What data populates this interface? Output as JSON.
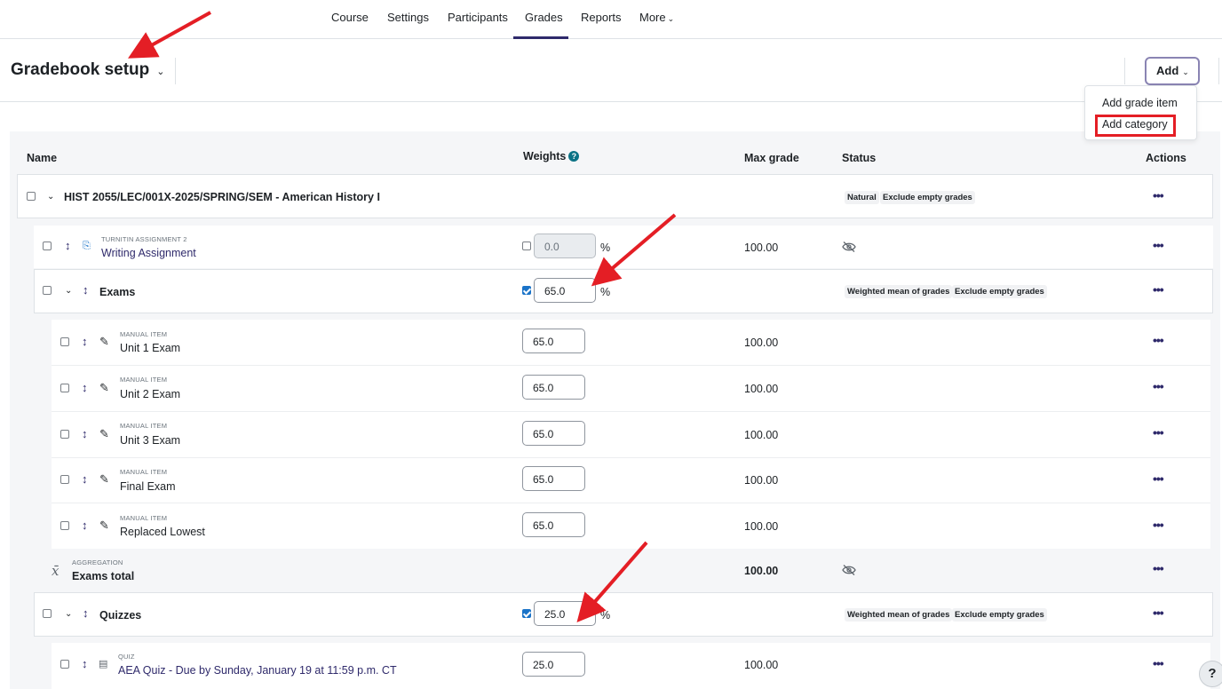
{
  "nav": {
    "items": [
      "Course",
      "Settings",
      "Participants",
      "Grades",
      "Reports",
      "More"
    ],
    "active": "Grades"
  },
  "header": {
    "title": "Gradebook setup",
    "add_button": "Add"
  },
  "add_menu": {
    "items": [
      "Add grade item",
      "Add category"
    ],
    "highlighted": "Add category"
  },
  "table": {
    "columns": {
      "name": "Name",
      "weights": "Weights",
      "max_grade": "Max grade",
      "status": "Status",
      "actions": "Actions"
    },
    "course": {
      "name": "HIST 2055/LEC/001X-2025/SPRING/SEM - American History I",
      "status": [
        "Natural",
        "Exclude empty grades"
      ]
    },
    "writing": {
      "type": "TURNITIN ASSIGNMENT 2",
      "name": "Writing Assignment",
      "weight": "0.0",
      "weight_checked": false,
      "pct": "%",
      "max": "100.00"
    },
    "exams": {
      "name": "Exams",
      "weight": "65.0",
      "weight_checked": true,
      "pct": "%",
      "status": [
        "Weighted mean of grades",
        "Exclude empty grades"
      ],
      "items": [
        {
          "type": "MANUAL ITEM",
          "name": "Unit 1 Exam",
          "weight": "65.0",
          "max": "100.00"
        },
        {
          "type": "MANUAL ITEM",
          "name": "Unit 2 Exam",
          "weight": "65.0",
          "max": "100.00"
        },
        {
          "type": "MANUAL ITEM",
          "name": "Unit 3 Exam",
          "weight": "65.0",
          "max": "100.00"
        },
        {
          "type": "MANUAL ITEM",
          "name": "Final Exam",
          "weight": "65.0",
          "max": "100.00"
        },
        {
          "type": "MANUAL ITEM",
          "name": "Replaced Lowest",
          "weight": "65.0",
          "max": "100.00"
        }
      ],
      "total": {
        "type": "AGGREGATION",
        "name": "Exams total",
        "max": "100.00"
      }
    },
    "quizzes": {
      "name": "Quizzes",
      "weight": "25.0",
      "weight_checked": true,
      "pct": "%",
      "status": [
        "Weighted mean of grades",
        "Exclude empty grades"
      ],
      "items": [
        {
          "type": "QUIZ",
          "name": "AEA Quiz - Due by Sunday, January 19 at 11:59 p.m. CT",
          "weight": "25.0",
          "max": "100.00"
        }
      ]
    }
  },
  "help_button": "?",
  "colors": {
    "accent": "#2f2a6b",
    "annotation_red": "#e41e25",
    "checkbox_blue": "#1a73c8",
    "background_gray": "#f5f6f8"
  }
}
